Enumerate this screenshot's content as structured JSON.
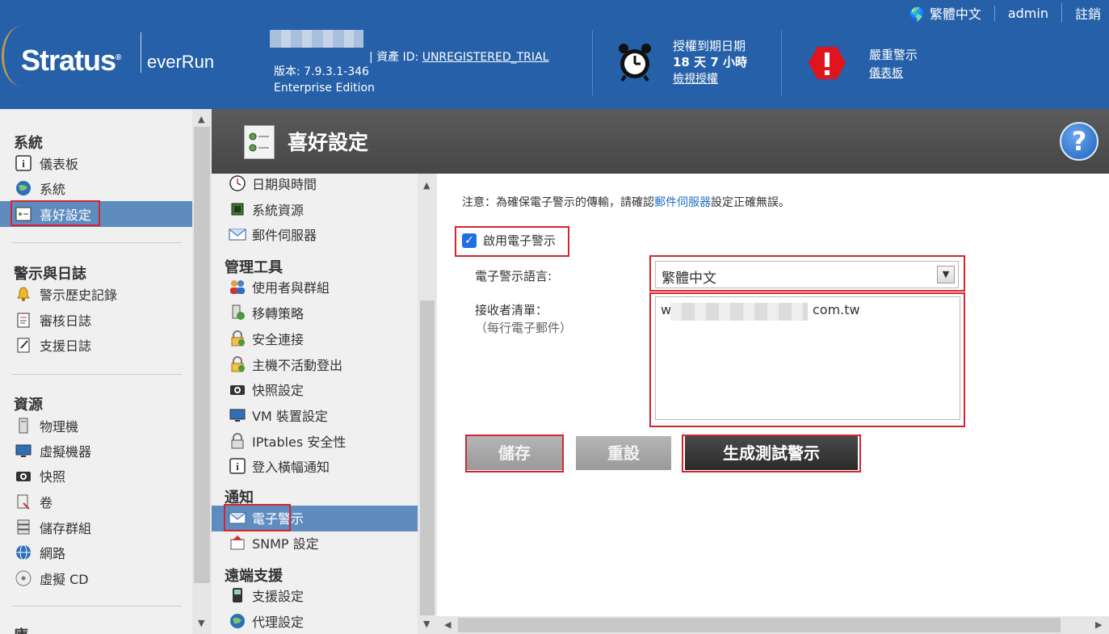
{
  "header": {
    "brand": "Stratus",
    "product": "everRun",
    "asset_label": "資產 ID:",
    "asset_id": "UNREGISTERED_TRIAL",
    "version": "版本: 7.9.3.1-346",
    "edition": "Enterprise Edition",
    "license_title": "授權到期日期",
    "license_remaining": "18 天 7 小時",
    "license_link": "檢視授權",
    "alert_title": "嚴重警示",
    "alert_link": "儀表板"
  },
  "user_nav": {
    "language": "繁體中文",
    "user": "admin",
    "logout": "註銷"
  },
  "sidebar": {
    "sections": [
      {
        "title": "系統",
        "items": [
          {
            "label": "儀表板",
            "icon": "info-icon"
          },
          {
            "label": "系統",
            "icon": "globe-icon"
          },
          {
            "label": "喜好設定",
            "icon": "preferences-icon",
            "selected": true
          }
        ]
      },
      {
        "title": "警示與日誌",
        "items": [
          {
            "label": "警示歷史記錄",
            "icon": "bell-icon"
          },
          {
            "label": "審核日誌",
            "icon": "notepad-icon"
          },
          {
            "label": "支援日誌",
            "icon": "log-icon"
          }
        ]
      },
      {
        "title": "資源",
        "items": [
          {
            "label": "物理機",
            "icon": "server-icon"
          },
          {
            "label": "虛擬機器",
            "icon": "monitor-icon"
          },
          {
            "label": "快照",
            "icon": "camera-icon"
          },
          {
            "label": "卷",
            "icon": "volume-icon"
          },
          {
            "label": "儲存群組",
            "icon": "storage-icon"
          },
          {
            "label": "網路",
            "icon": "network-icon"
          },
          {
            "label": "虛擬 CD",
            "icon": "cd-icon"
          }
        ]
      },
      {
        "title": "庫"
      }
    ]
  },
  "page": {
    "title": "喜好設定",
    "help_label": "?"
  },
  "submenu": {
    "items": [
      {
        "label": "日期與時間",
        "icon": "clock-icon"
      },
      {
        "label": "系統資源",
        "icon": "chip-icon"
      },
      {
        "label": "郵件伺服器",
        "icon": "mail-icon"
      }
    ],
    "admin_title": "管理工具",
    "admin_items": [
      {
        "label": "使用者與群組",
        "icon": "users-icon"
      },
      {
        "label": "移轉策略",
        "icon": "migrate-icon"
      },
      {
        "label": "安全連接",
        "icon": "lock-icon"
      },
      {
        "label": "主機不活動登出",
        "icon": "lock-icon"
      },
      {
        "label": "快照設定",
        "icon": "camera-icon"
      },
      {
        "label": "VM 裝置設定",
        "icon": "monitor-icon"
      },
      {
        "label": "IPtables 安全性",
        "icon": "lock-icon"
      },
      {
        "label": "登入橫幅通知",
        "icon": "info-icon"
      }
    ],
    "notify_title": "通知",
    "notify_items": [
      {
        "label": "電子警示",
        "icon": "mail-icon",
        "selected": true
      },
      {
        "label": "SNMP 設定",
        "icon": "snmp-icon"
      }
    ],
    "remote_title": "遠端支援",
    "remote_items": [
      {
        "label": "支援設定",
        "icon": "phone-icon"
      },
      {
        "label": "代理設定",
        "icon": "globe-icon"
      }
    ]
  },
  "main": {
    "note_prefix": "注意：為確保電子警示的傳輸，請確認",
    "note_link": "郵件伺服器",
    "note_suffix": "設定正確無誤。",
    "enable_label": "啟用電子警示",
    "enable_checked": true,
    "lang_label": "電子警示語言:",
    "lang_value": "繁體中文",
    "recipient_label": "接收者清單：",
    "recipient_hint": "（每行電子郵件）",
    "recipient_start": "w",
    "recipient_end": "com.tw",
    "save_label": "儲存",
    "reset_label": "重設",
    "test_label": "生成測試警示"
  },
  "colors": {
    "topbar": "#2560a8",
    "selected": "#5f8cbf",
    "highlight": "#d6242e",
    "link": "#1f6fc6"
  }
}
